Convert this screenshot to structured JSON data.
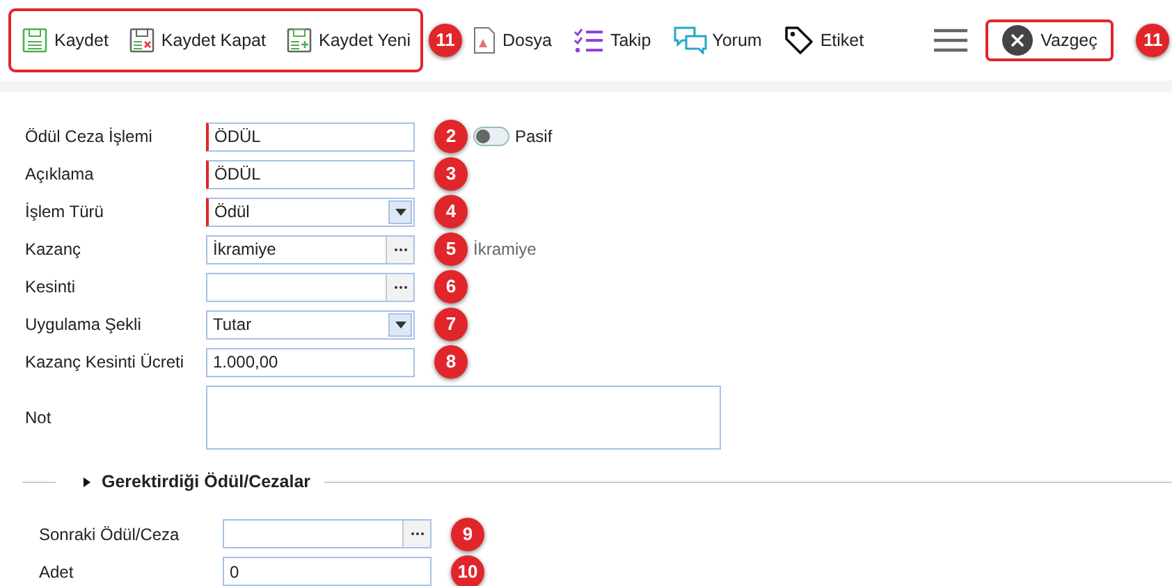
{
  "toolbar": {
    "highlighted_group": {
      "badge": "11",
      "buttons": [
        {
          "label": "Kaydet"
        },
        {
          "label": "Kaydet Kapat"
        },
        {
          "label": "Kaydet Yeni"
        }
      ]
    },
    "buttons": [
      {
        "label": "Dosya"
      },
      {
        "label": "Takip"
      },
      {
        "label": "Yorum"
      },
      {
        "label": "Etiket"
      }
    ],
    "cancel": {
      "label": "Vazgeç",
      "badge": "11"
    }
  },
  "form": {
    "fields": [
      {
        "label": "Ödül Ceza İşlemi",
        "kind": "text",
        "value": "ÖDÜL",
        "required": true,
        "badge": "2",
        "toggle": {
          "label": "Pasif",
          "on": false
        }
      },
      {
        "label": "Açıklama",
        "kind": "text",
        "value": "ÖDÜL",
        "required": true,
        "badge": "3"
      },
      {
        "label": "İşlem Türü",
        "kind": "select",
        "value": "Ödül",
        "required": true,
        "badge": "4"
      },
      {
        "label": "Kazanç",
        "kind": "lookup",
        "value": "İkramiye",
        "required": false,
        "badge": "5",
        "note": "İkramiye"
      },
      {
        "label": "Kesinti",
        "kind": "lookup",
        "required": false,
        "badge": "6"
      },
      {
        "label": "Uygulama Şekli",
        "kind": "select",
        "value": "Tutar",
        "required": false,
        "badge": "7"
      },
      {
        "label": "Kazanç Kesinti Ücreti",
        "kind": "text",
        "value": "1.000,00",
        "required": false,
        "badge": "8"
      },
      {
        "label": "Not",
        "kind": "textarea",
        "required": false
      }
    ]
  },
  "section": {
    "title": "Gerektirdiği Ödül/Cezalar",
    "expanded": false,
    "fields": [
      {
        "label": "Sonraki Ödül/Ceza",
        "kind": "lookup",
        "required": false,
        "badge": "9"
      },
      {
        "label": "Adet",
        "kind": "text",
        "value": "0",
        "required": false,
        "badge": "10"
      }
    ]
  }
}
